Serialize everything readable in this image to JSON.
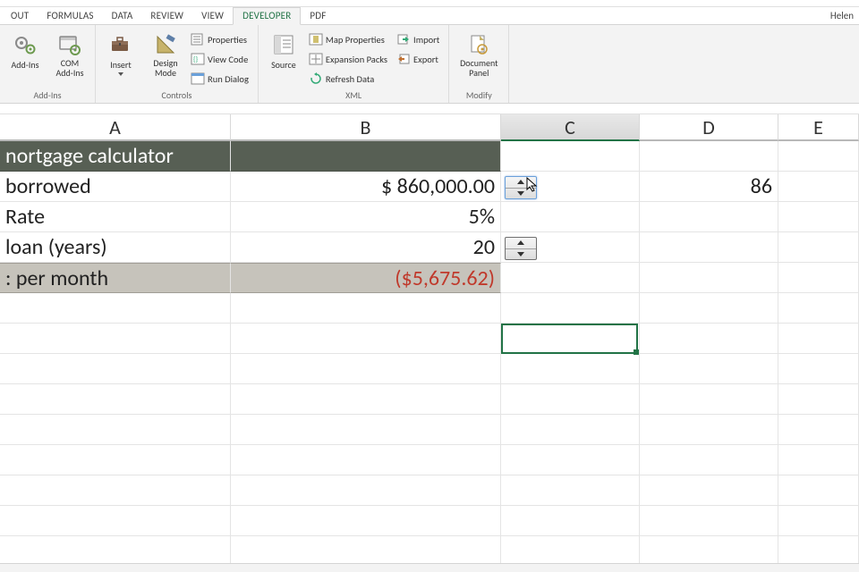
{
  "user_name": "Helen",
  "tabs": {
    "t0": "OUT",
    "t1": "Formulas",
    "t2": "Data",
    "t3": "Review",
    "t4": "View",
    "t5": "Developer",
    "t6": "PDF"
  },
  "ribbon": {
    "addins": {
      "addins": "Add-Ins",
      "com": "COM\nAdd-Ins",
      "group": "Add-Ins"
    },
    "controls": {
      "insert": "Insert",
      "design": "Design\nMode",
      "properties": "Properties",
      "viewcode": "View Code",
      "rundialog": "Run Dialog",
      "group": "Controls"
    },
    "xml": {
      "source": "Source",
      "mapprops": "Map Properties",
      "expansion": "Expansion Packs",
      "refresh": "Refresh Data",
      "import": "Import",
      "export": "Export",
      "group": "XML"
    },
    "modify": {
      "docpanel": "Document\nPanel",
      "group": "Modify"
    }
  },
  "columns": {
    "A": "A",
    "B": "B",
    "C": "C",
    "D": "D",
    "E": "E"
  },
  "cells": {
    "title": "nortgage calculator",
    "r2a": "borrowed",
    "r2b": "$  860,000.00",
    "r2d": "86",
    "r3a": "Rate",
    "r3b": "5%",
    "r4a": "loan (years)",
    "r4b": "20",
    "r5a": ": per month",
    "r5b": "($5,675.62)"
  }
}
